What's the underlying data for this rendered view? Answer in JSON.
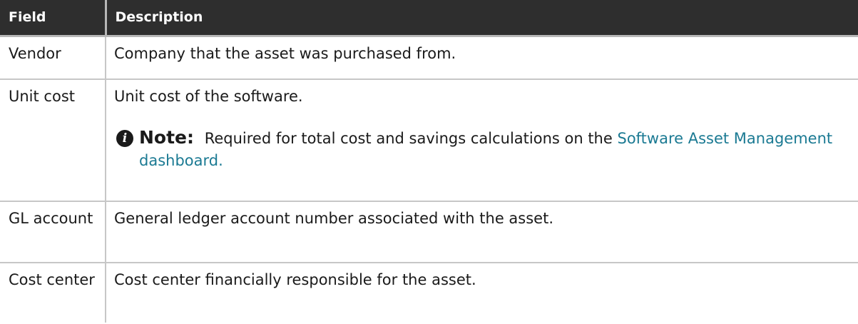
{
  "table": {
    "headers": {
      "field": "Field",
      "description": "Description"
    },
    "rows": [
      {
        "field": "Vendor",
        "description": "Company that the asset was purchased from."
      },
      {
        "field": "Unit cost",
        "description": "Unit cost of the software.",
        "note": {
          "icon": "info-icon",
          "label": "Note:",
          "text": "Required for total cost and savings calculations on the",
          "link": "Software Asset Management dashboard."
        }
      },
      {
        "field": "GL account",
        "description": "General ledger account number associated with the asset."
      },
      {
        "field": "Cost center",
        "description": "Cost center financially responsible for the asset."
      }
    ]
  },
  "colors": {
    "header_background": "#2e2e2e",
    "header_text": "#ffffff",
    "link": "#1b7a93",
    "border": "#c7c7c7"
  }
}
